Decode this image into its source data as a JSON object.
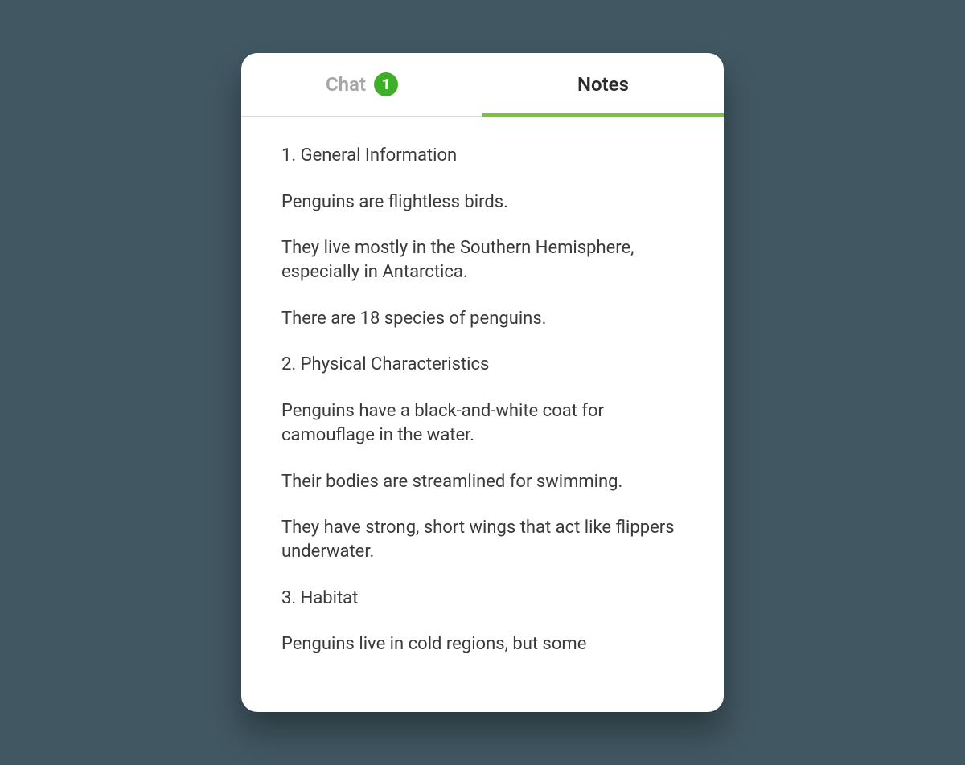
{
  "tabs": {
    "chat": {
      "label": "Chat",
      "badge": "1"
    },
    "notes": {
      "label": "Notes"
    }
  },
  "notes": {
    "lines": [
      "1. General Information",
      "Penguins are flightless birds.",
      "They live mostly in the Southern Hemisphere, especially in Antarctica.",
      "There are 18 species of penguins.",
      "2. Physical Characteristics",
      "Penguins have a black-and-white coat for camouflage in the water.",
      "Their bodies are streamlined for swimming.",
      "They have strong, short wings that act like flippers underwater.",
      "3. Habitat",
      "Penguins live in cold regions, but some"
    ]
  }
}
